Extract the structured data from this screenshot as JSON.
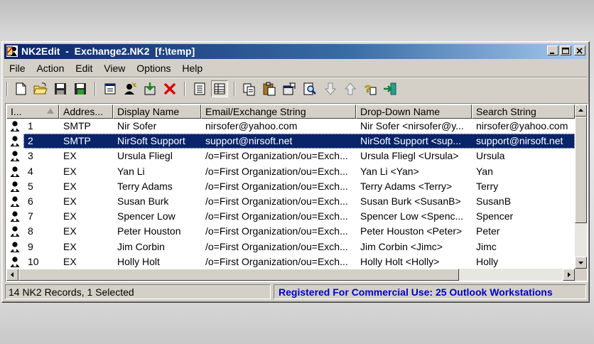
{
  "window": {
    "title": "NK2Edit  -  Exchange2.NK2  [f:\\temp]"
  },
  "menu": [
    "File",
    "Action",
    "Edit",
    "View",
    "Options",
    "Help"
  ],
  "toolbar_icons": [
    "new-file-icon",
    "open-folder-icon",
    "save-icon",
    "save-as-icon",
    "properties-icon",
    "new-contact-icon",
    "import-icon",
    "delete-icon",
    "list-view-icon",
    "details-view-icon",
    "copy-icon",
    "paste-icon",
    "edit-icon",
    "find-icon",
    "move-down-icon",
    "move-up-icon",
    "help-icon",
    "exit-icon"
  ],
  "columns": [
    "I...",
    "Addres...",
    "Display Name",
    "Email/Exchange String",
    "Drop-Down Name",
    "Search String"
  ],
  "rows": [
    {
      "index": "1",
      "type": "SMTP",
      "display": "Nir Sofer",
      "email": "nirsofer@yahoo.com",
      "dropdown": "Nir Sofer <nirsofer@y...",
      "search": "nirsofer@yahoo.com"
    },
    {
      "index": "2",
      "type": "SMTP",
      "display": "NirSoft Support",
      "email": "support@nirsoft.net",
      "dropdown": "NirSoft Support <sup...",
      "search": "support@nirsoft.net"
    },
    {
      "index": "3",
      "type": "EX",
      "display": "Ursula Fliegl",
      "email": "/o=First Organization/ou=Exch...",
      "dropdown": "Ursula Fliegl <Ursula>",
      "search": "Ursula"
    },
    {
      "index": "4",
      "type": "EX",
      "display": "Yan Li",
      "email": "/o=First Organization/ou=Exch...",
      "dropdown": "Yan Li <Yan>",
      "search": "Yan"
    },
    {
      "index": "5",
      "type": "EX",
      "display": "Terry Adams",
      "email": "/o=First Organization/ou=Exch...",
      "dropdown": "Terry Adams <Terry>",
      "search": "Terry"
    },
    {
      "index": "6",
      "type": "EX",
      "display": "Susan Burk",
      "email": "/o=First Organization/ou=Exch...",
      "dropdown": "Susan Burk <SusanB>",
      "search": "SusanB"
    },
    {
      "index": "7",
      "type": "EX",
      "display": "Spencer Low",
      "email": "/o=First Organization/ou=Exch...",
      "dropdown": "Spencer Low <Spenc...",
      "search": "Spencer"
    },
    {
      "index": "8",
      "type": "EX",
      "display": "Peter Houston",
      "email": "/o=First Organization/ou=Exch...",
      "dropdown": "Peter Houston <Peter>",
      "search": "Peter"
    },
    {
      "index": "9",
      "type": "EX",
      "display": "Jim Corbin",
      "email": "/o=First Organization/ou=Exch...",
      "dropdown": "Jim Corbin <Jimc>",
      "search": "Jimc"
    },
    {
      "index": "10",
      "type": "EX",
      "display": "Holly Holt",
      "email": "/o=First Organization/ou=Exch...",
      "dropdown": "Holly Holt <Holly>",
      "search": "Holly"
    }
  ],
  "selected_row": 1,
  "status": {
    "records": "14 NK2 Records, 1 Selected",
    "registration": "Registered For Commercial Use:  25 Outlook Workstations"
  },
  "colors": {
    "title_bar": "#0a246a",
    "selection": "#0a246a",
    "registration_text": "#0000cc",
    "face": "#d4d0c8"
  }
}
